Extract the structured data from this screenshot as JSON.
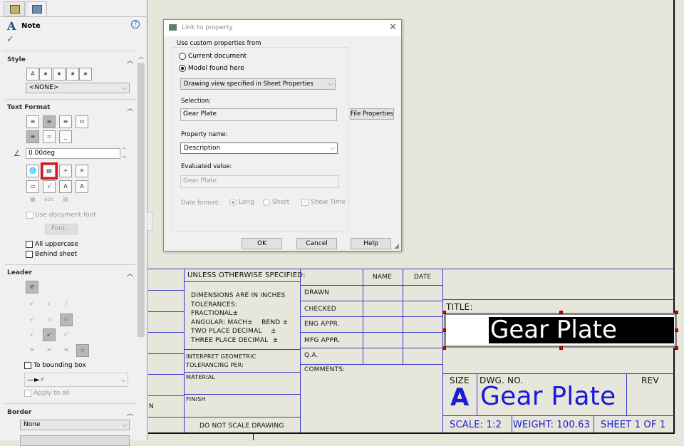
{
  "panel": {
    "tabs": [
      {
        "icon": "feature-manager-icon"
      },
      {
        "icon": "property-manager-icon"
      }
    ],
    "title": "Note",
    "style": {
      "label": "Style",
      "select": "<NONE>"
    },
    "text_format": {
      "label": "Text Format",
      "angle": "0.00deg",
      "use_document_font": "Use document font",
      "font_button": "Font...",
      "all_uppercase": "All uppercase",
      "behind_sheet": "Behind sheet"
    },
    "leader": {
      "label": "Leader",
      "to_bounding_box": "To bounding box",
      "apply_to_all": "Apply to all"
    },
    "border": {
      "label": "Border",
      "select": "None"
    }
  },
  "dialog": {
    "title": "Link to property",
    "group": "Use custom properties from",
    "current_document": "Current document",
    "model_found_here": "Model found here",
    "model_select": "Drawing view specified in Sheet Properties",
    "selection_label": "Selection:",
    "selection_value": "Gear Plate",
    "file_properties": "File Properties",
    "property_name_label": "Property name:",
    "property_name_value": "Description",
    "evaluated_label": "Evaluated value:",
    "evaluated_value": "Gear Plate",
    "date_format_label": "Date format:",
    "long": "Long",
    "short": "Short",
    "show_time": "Show Time",
    "ok": "OK",
    "cancel": "Cancel",
    "help": "Help"
  },
  "title_block": {
    "unless": "UNLESS OTHERWISE SPECIFIED:",
    "dims": [
      "DIMENSIONS ARE IN INCHES",
      "TOLERANCES:",
      "FRACTIONAL±",
      "ANGULAR: MACH±    BEND ±",
      "TWO PLACE DECIMAL    ±",
      "THREE PLACE DECIMAL  ±"
    ],
    "interpret": [
      "INTERPRET GEOMETRIC",
      "TOLERANCING PER:"
    ],
    "material": "MATERIAL",
    "finish": "FINISH",
    "do_not_scale": "DO NOT SCALE DRAWING",
    "left_partial": "N",
    "name": "NAME",
    "date": "DATE",
    "rows": [
      "DRAWN",
      "CHECKED",
      "ENG APPR.",
      "MFG APPR.",
      "Q.A."
    ],
    "comments": "COMMENTS:",
    "title_label": "TITLE:",
    "title_value": "Gear Plate",
    "size_label": "SIZE",
    "size_value": "A",
    "dwg_no_label": "DWG.  NO.",
    "dwg_no_value": "Gear Plate",
    "rev_label": "REV",
    "scale": "SCALE: 1:2",
    "weight": "WEIGHT: 100.63",
    "sheet": "SHEET 1 OF 1"
  },
  "colors": {
    "line": "#3a3acd",
    "value_text": "#1a1ad8",
    "highlight": "#d01020"
  }
}
